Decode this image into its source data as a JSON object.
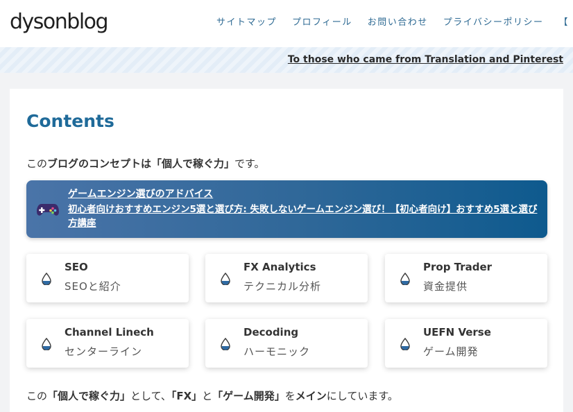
{
  "header": {
    "logo_text": "dysonblog",
    "nav": [
      "サイトマップ",
      "プロフィール",
      "お問い合わせ",
      "プライバシーポリシー",
      "【"
    ]
  },
  "notice": {
    "text": "To those who came from Translation and Pinterest"
  },
  "content": {
    "title": "Contents",
    "concept": {
      "pre": "この",
      "bold": "ブログのコンセプトは「個人で稼ぐ力」",
      "post": "です。"
    },
    "banner": {
      "icon": "gamepad-icon",
      "title": "ゲームエンジン選びのアドバイス",
      "description": "初心者向けおすすめエンジン5選と選び方: 失敗しないゲームエンジン選び！【初心者向け】おすすめ5選と選び方講座"
    },
    "cards": [
      {
        "title": "SEO",
        "subtitle": "SEOと紹介",
        "icon": "water-drop-icon"
      },
      {
        "title": "FX Analytics",
        "subtitle": "テクニカル分析",
        "icon": "water-drop-icon"
      },
      {
        "title": "Prop Trader",
        "subtitle": "資金提供",
        "icon": "water-drop-icon"
      },
      {
        "title": "Channel Linech",
        "subtitle": "センターライン",
        "icon": "water-drop-icon"
      },
      {
        "title": "Decoding",
        "subtitle": "ハーモニック",
        "icon": "water-drop-icon"
      },
      {
        "title": "UEFN Verse",
        "subtitle": "ゲーム開発",
        "icon": "water-drop-icon"
      }
    ],
    "footer": {
      "p1": "この",
      "b1": "「個人で稼ぐ力」",
      "p2": "として、",
      "b2": "「FX」",
      "p3": "と",
      "b3": "「ゲーム開発」",
      "p4": "を",
      "b4": "メイン",
      "p5": "にしています。"
    }
  },
  "colors": {
    "accent": "#1f6a99",
    "nav_link": "#2e6a93",
    "banner_start": "#4a74a8",
    "banner_end": "#0e5a8e",
    "drop_fill": "#2f6aa3"
  }
}
